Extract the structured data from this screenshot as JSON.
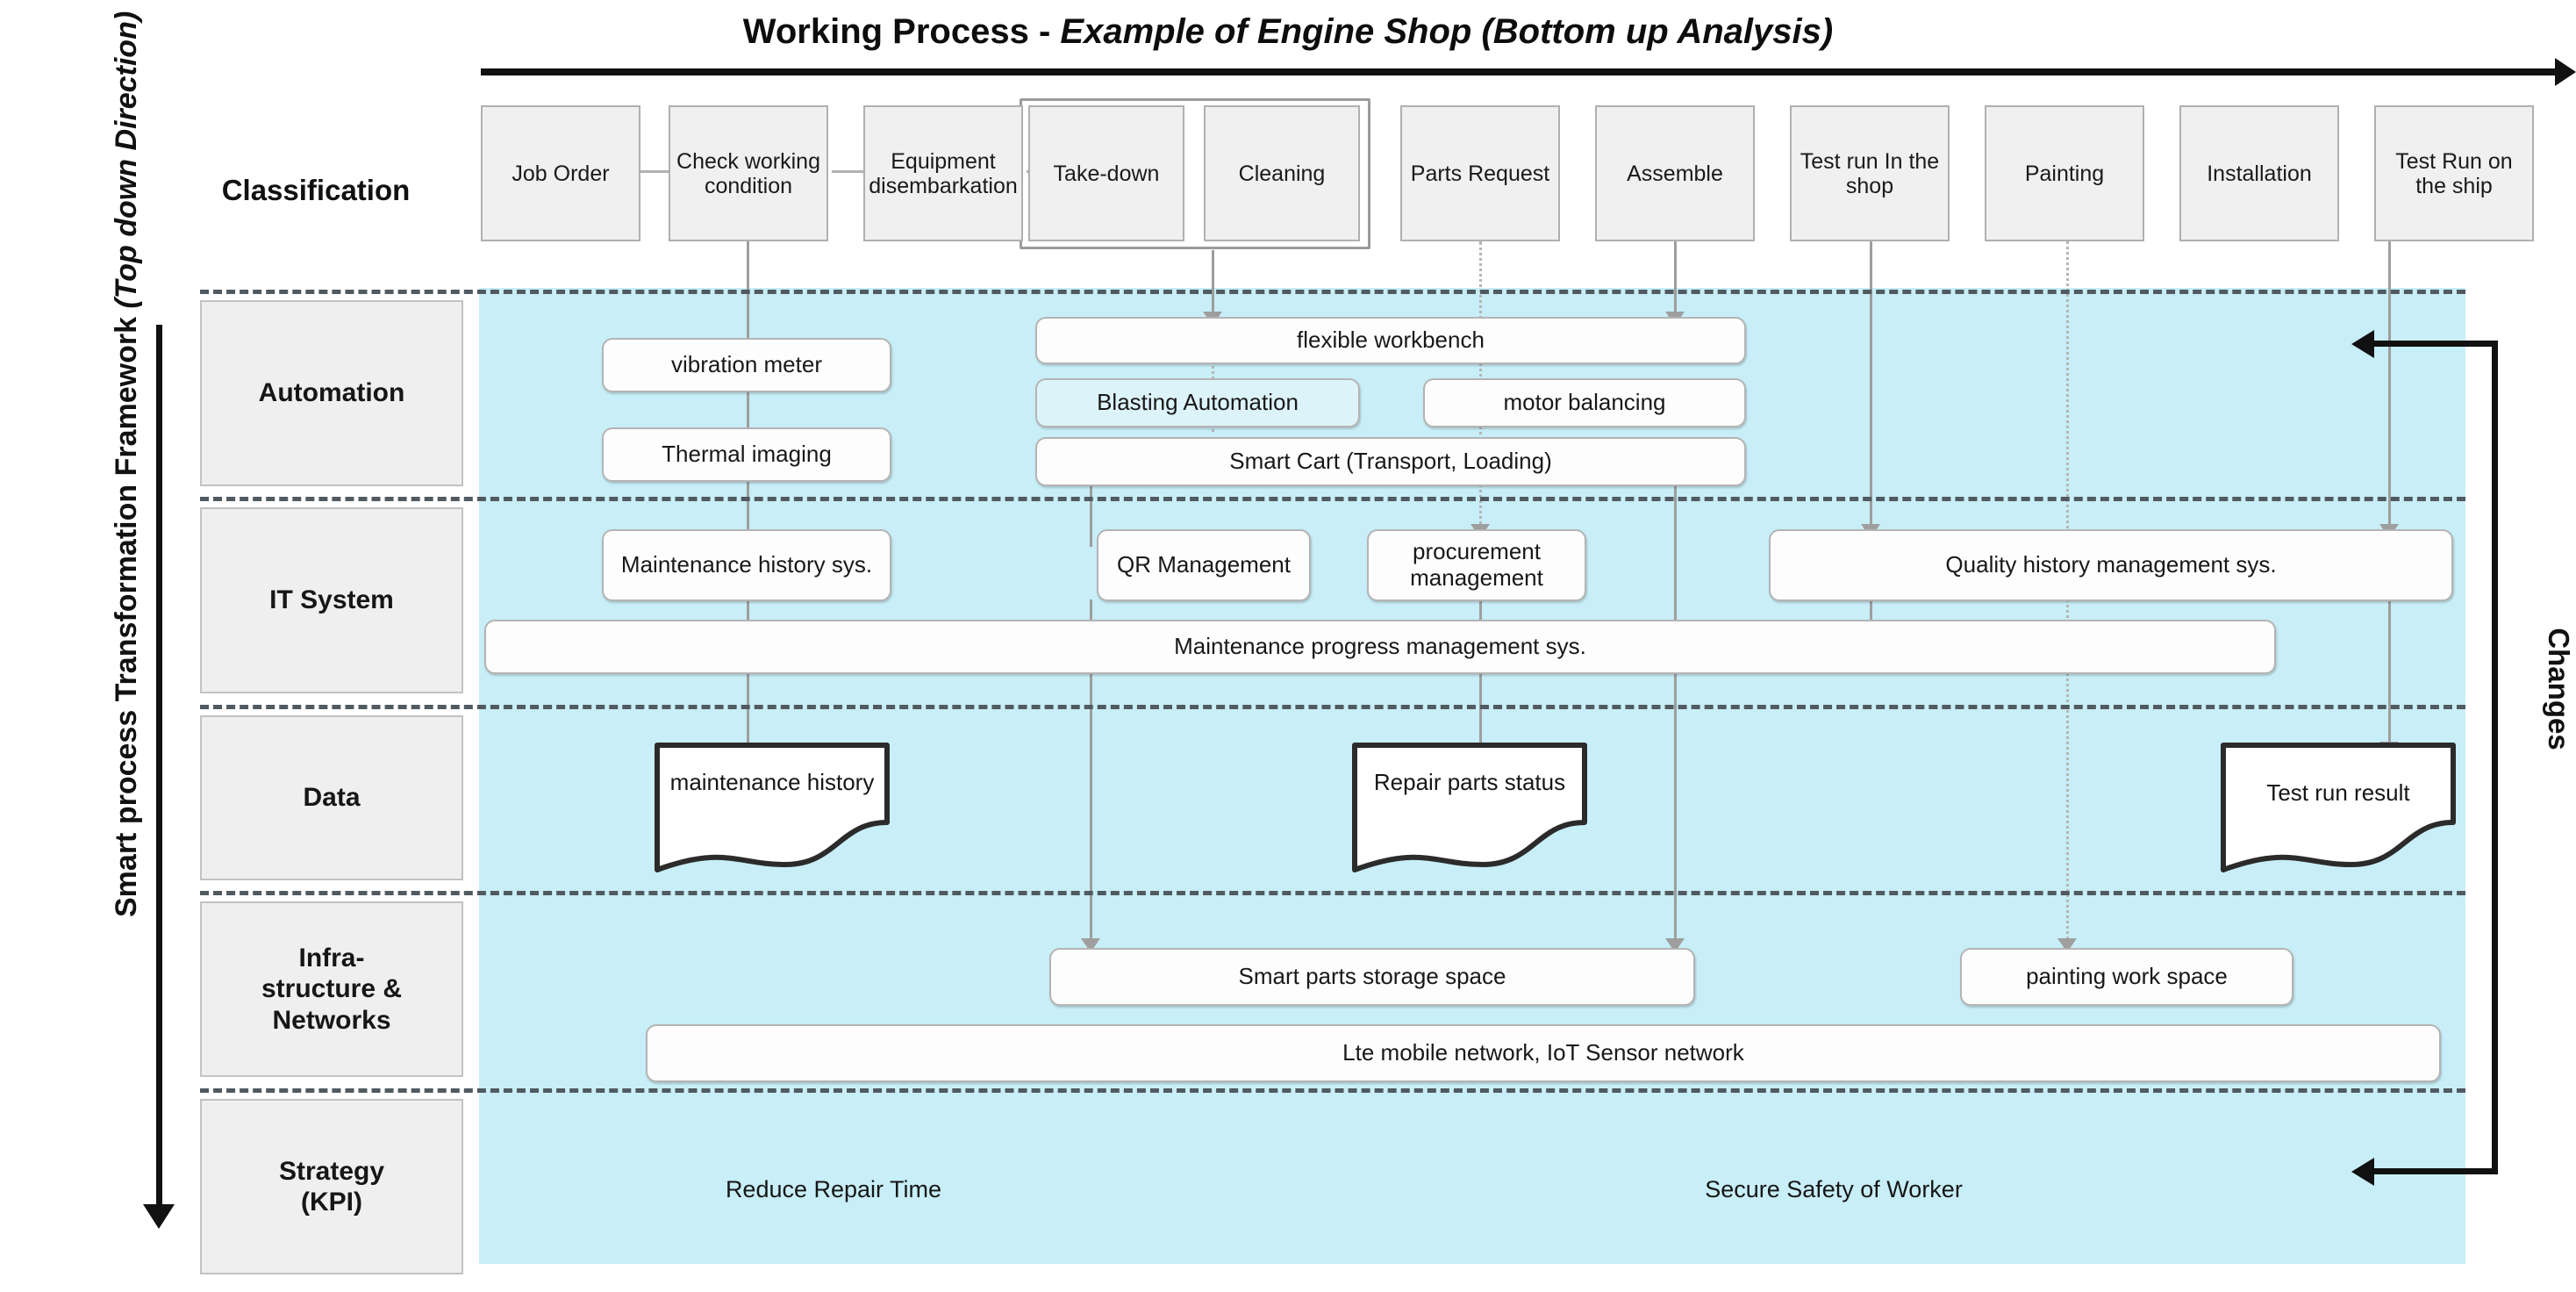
{
  "title": {
    "main": "Working Process",
    "dash": " - ",
    "subtitle": "Example of Engine Shop (Bottom up Analysis)"
  },
  "classification_label": "Classification",
  "framework_axis": {
    "line1": "Smart process Transformation Framework",
    "line2": "(Top down Direction)"
  },
  "changes_label": "Changes",
  "process_steps": [
    {
      "label": "Job Order"
    },
    {
      "label": "Check working condition"
    },
    {
      "label": "Equipment disembarkation"
    },
    {
      "label": "Take-down"
    },
    {
      "label": "Cleaning"
    },
    {
      "label": "Parts Request"
    },
    {
      "label": "Assemble"
    },
    {
      "label": "Test run In the shop"
    },
    {
      "label": "Painting"
    },
    {
      "label": "Installation"
    },
    {
      "label": "Test Run on the ship"
    }
  ],
  "rows": [
    {
      "id": "automation",
      "label": "Automation"
    },
    {
      "id": "it-system",
      "label": "IT System"
    },
    {
      "id": "data",
      "label": "Data"
    },
    {
      "id": "infrastructure",
      "label": "Infra-\nstructure &\nNetworks"
    },
    {
      "id": "strategy",
      "label": "Strategy\n(KPI)"
    }
  ],
  "automation_items": [
    {
      "label": "vibration meter"
    },
    {
      "label": "Thermal imaging"
    },
    {
      "label": "flexible workbench"
    },
    {
      "label": "Blasting Automation"
    },
    {
      "label": "motor balancing"
    },
    {
      "label": "Smart Cart (Transport, Loading)"
    }
  ],
  "it_system_items": [
    {
      "label": "Maintenance history sys."
    },
    {
      "label": "QR Management"
    },
    {
      "label": "procurement management"
    },
    {
      "label": "Quality history management sys."
    },
    {
      "label": "Maintenance progress management sys."
    }
  ],
  "data_items": [
    {
      "label": "maintenance history"
    },
    {
      "label": "Repair parts status"
    },
    {
      "label": "Test run result"
    }
  ],
  "infrastructure_items": [
    {
      "label": "Smart parts storage space"
    },
    {
      "label": "painting work space"
    },
    {
      "label": "Lte mobile network, IoT Sensor network"
    }
  ],
  "strategy_items": [
    {
      "label": "Reduce Repair Time"
    },
    {
      "label": "Secure Safety of Worker"
    }
  ],
  "colors": {
    "panel_blue": "#c8eef7",
    "tinted_box": "#ddf3fa",
    "box_fill": "#fdfdfd",
    "label_fill": "#efefef",
    "process_fill": "#f0f0f0",
    "line_gray": "#9e9e9e",
    "dash_dark": "#505a60",
    "ink": "#111111"
  }
}
